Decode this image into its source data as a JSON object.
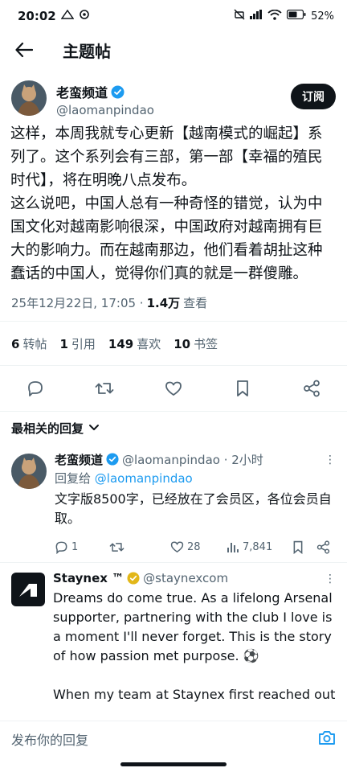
{
  "status": {
    "time": "20:02",
    "battery": "52"
  },
  "header": {
    "title": "主题帖"
  },
  "post": {
    "author_name": "老蛮频道",
    "author_handle": "@laomanpindao",
    "subscribe_label": "订阅",
    "text": "这样，本周我就专心更新【越南模式的崛起】系列了。这个系列会有三部，第一部【幸福的殖民时代】，将在明晚八点发布。\n这么说吧，中国人总有一种奇怪的错觉，认为中国文化对越南影响很深，中国政府对越南拥有巨大的影响力。而在越南那边，他们看着胡扯这种蠢话的中国人，觉得你们真的就是一群傻雕。",
    "timestamp": "25年12月22日, 17:05 ·",
    "views_count": "1.4万",
    "views_label": "查看"
  },
  "stats": [
    {
      "count": "6",
      "label": "转帖"
    },
    {
      "count": "1",
      "label": "引用"
    },
    {
      "count": "149",
      "label": "喜欢"
    },
    {
      "count": "10",
      "label": "书签"
    }
  ],
  "sort": {
    "label": "最相关的回复"
  },
  "replies": [
    {
      "name": "老蛮频道",
      "handle": "@laomanpindao · 2小时",
      "reply_to_prefix": "回复给",
      "reply_to_handle": "@laomanpindao",
      "text": "文字版8500字，已经放在了会员区，各位会员自取。",
      "replies": "1",
      "likes": "28",
      "views": "7,841"
    },
    {
      "name": "Staynex ™",
      "handle": "@staynexcom",
      "text": "Dreams do come true. As a lifelong Arsenal supporter, partnering with the club I love is a moment I'll never forget. This is the story of how passion met purpose. ⚽\n\nWhen my team at Staynex first reached out to Arsenal, we were hopeful but realistic."
    }
  ],
  "compose": {
    "placeholder": "发布你的回复"
  },
  "colors": {
    "accent": "#1d9bf0",
    "text": "#0f1419",
    "secondary": "#536471",
    "gold": "#e2b719"
  }
}
